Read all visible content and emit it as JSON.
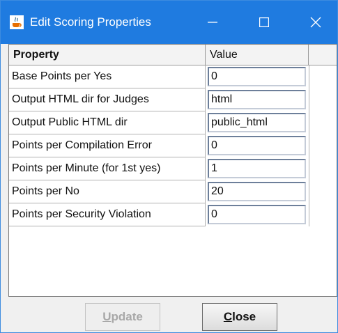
{
  "window": {
    "title": "Edit Scoring Properties",
    "app_icon": "java-cup-icon",
    "controls": {
      "minimize": "minimize-icon",
      "maximize": "maximize-icon",
      "close": "close-icon"
    }
  },
  "table": {
    "columns": [
      "Property",
      "Value"
    ],
    "rows": [
      {
        "property": "Base Points per Yes",
        "value": "0"
      },
      {
        "property": "Output HTML dir for Judges",
        "value": "html"
      },
      {
        "property": "Output Public HTML dir",
        "value": "public_html"
      },
      {
        "property": "Points per Compilation Error",
        "value": "0"
      },
      {
        "property": "Points per Minute (for 1st yes)",
        "value": "1"
      },
      {
        "property": "Points per No",
        "value": "20"
      },
      {
        "property": "Points per Security Violation",
        "value": "0"
      }
    ]
  },
  "buttons": {
    "update": {
      "mnemonic": "U",
      "rest": "pdate",
      "enabled": false
    },
    "close": {
      "mnemonic": "C",
      "rest": "lose",
      "enabled": true
    }
  },
  "colors": {
    "titlebar": "#1f7be0",
    "window_bg": "#f0f0f0"
  }
}
